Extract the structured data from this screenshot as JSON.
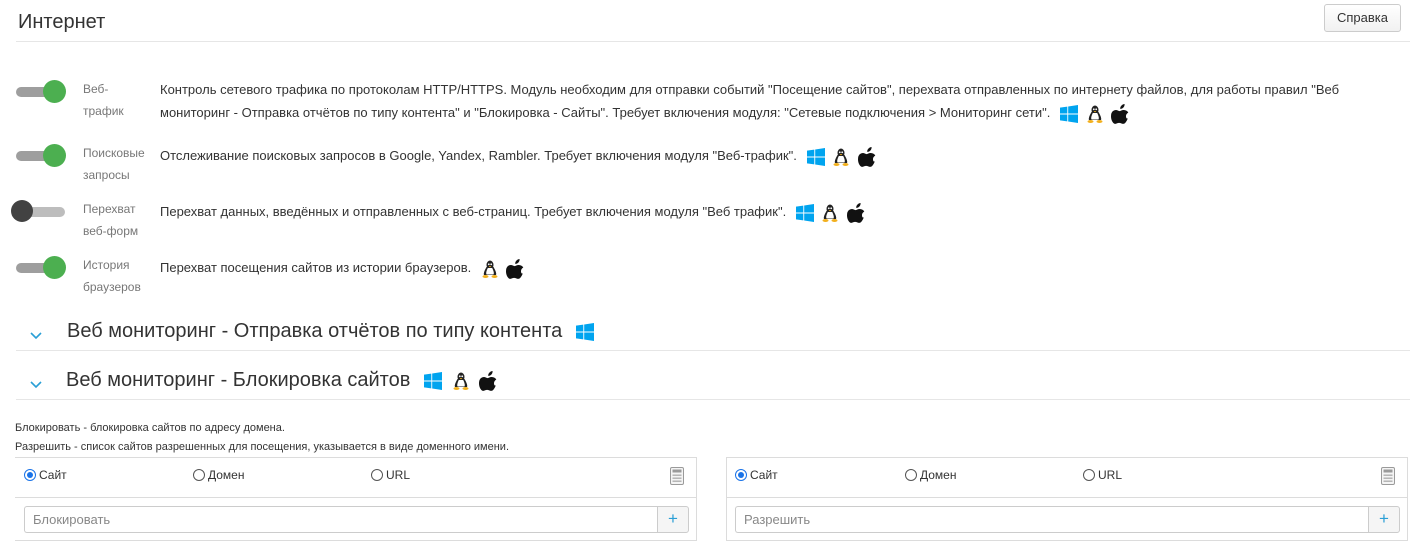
{
  "header": {
    "title": "Интернет",
    "help_label": "Справка"
  },
  "settings": [
    {
      "name_line1": "Веб-",
      "name_line2": "трафик",
      "enabled": true,
      "description": "Контроль сетевого трафика по протоколам HTTP/HTTPS. Модуль необходим для отправки событий \"Посещение сайтов\", перехвата отправленных по интернету файлов, для работы правил \"Веб мониторинг - Отправка отчётов по типу контента\" и \"Блокировка - Сайты\". Требует включения модуля: \"Сетевые подключения > Мониторинг сети\".",
      "os": [
        "windows-icon",
        "linux-icon",
        "apple-icon"
      ]
    },
    {
      "name_line1": "Поисковые",
      "name_line2": "запросы",
      "enabled": true,
      "description": "Отслеживание поисковых запросов в Google, Yandex, Rambler. Требует включения модуля \"Веб-трафик\".",
      "os": [
        "windows-icon",
        "linux-icon",
        "apple-icon"
      ]
    },
    {
      "name_line1": "Перехват",
      "name_line2": "веб-форм",
      "enabled": false,
      "description": "Перехват данных, введённых и отправленных с веб-страниц. Требует включения модуля \"Веб трафик\".",
      "os": [
        "windows-icon",
        "linux-icon",
        "apple-icon"
      ]
    },
    {
      "name_line1": "История",
      "name_line2": "браузеров",
      "enabled": true,
      "description": "Перехват посещения сайтов из истории браузеров.",
      "os": [
        "linux-icon",
        "apple-icon"
      ]
    }
  ],
  "sections": [
    {
      "title": "Веб мониторинг - Отправка отчётов по типу контента",
      "os": [
        "windows-icon"
      ]
    },
    {
      "title": "Веб мониторинг - Блокировка сайтов",
      "os": [
        "windows-icon",
        "linux-icon",
        "apple-icon"
      ]
    }
  ],
  "notes": {
    "block": "Блокировать - блокировка сайтов по адресу домена.",
    "allow": "Разрешить - список сайтов разрешенных для посещения, указывается в виде доменного имени."
  },
  "panels": {
    "block": {
      "radios": [
        "Сайт",
        "Домен",
        "URL"
      ],
      "selected": "Сайт",
      "placeholder": "Блокировать",
      "add_label": "+"
    },
    "allow": {
      "radios": [
        "Сайт",
        "Домен",
        "URL"
      ],
      "selected": "Сайт",
      "placeholder": "Разрешить",
      "add_label": "+"
    }
  },
  "colors": {
    "toggle_on": "#4caf50",
    "toggle_off_knob": "#424242",
    "windows": "#00a4ef",
    "accent": "#1a73e8",
    "add_button": "#2a9fd6"
  }
}
